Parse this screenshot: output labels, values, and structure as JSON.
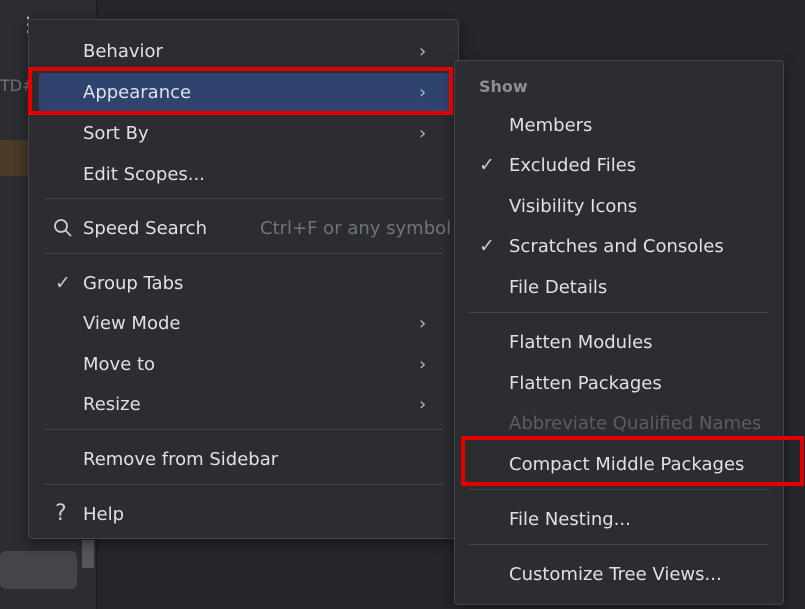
{
  "background": {
    "sidebar_text": "TD#"
  },
  "main_menu": {
    "items": [
      {
        "label": "Behavior",
        "submenu": true
      },
      {
        "label": "Appearance",
        "submenu": true,
        "selected": true
      },
      {
        "label": "Sort By",
        "submenu": true
      },
      {
        "label": "Edit Scopes..."
      },
      {
        "label": "Speed Search",
        "shortcut": "Ctrl+F or any symbol"
      },
      {
        "label": "Group Tabs",
        "checked": true
      },
      {
        "label": "View Mode",
        "submenu": true
      },
      {
        "label": "Move to",
        "submenu": true
      },
      {
        "label": "Resize",
        "submenu": true
      },
      {
        "label": "Remove from Sidebar"
      },
      {
        "label": "Help"
      }
    ]
  },
  "sub_menu": {
    "header": "Show",
    "items": [
      {
        "label": "Members"
      },
      {
        "label": "Excluded Files",
        "checked": true
      },
      {
        "label": "Visibility Icons"
      },
      {
        "label": "Scratches and Consoles",
        "checked": true
      },
      {
        "label": "File Details"
      },
      {
        "label": "Flatten Modules"
      },
      {
        "label": "Flatten Packages"
      },
      {
        "label": "Abbreviate Qualified Names",
        "disabled": true
      },
      {
        "label": "Compact Middle Packages"
      },
      {
        "label": "File Nesting..."
      },
      {
        "label": "Customize Tree Views..."
      }
    ]
  },
  "icons": {
    "chevron": "chevron-right-icon",
    "check": "checkmark-icon",
    "search": "search-icon",
    "help": "question-mark-icon"
  },
  "colors": {
    "menu_bg": "#2b2d30",
    "selection": "#2e436e",
    "annotation_red": "#e50000",
    "text": "#dfe1e5",
    "muted": "#6f737a"
  }
}
